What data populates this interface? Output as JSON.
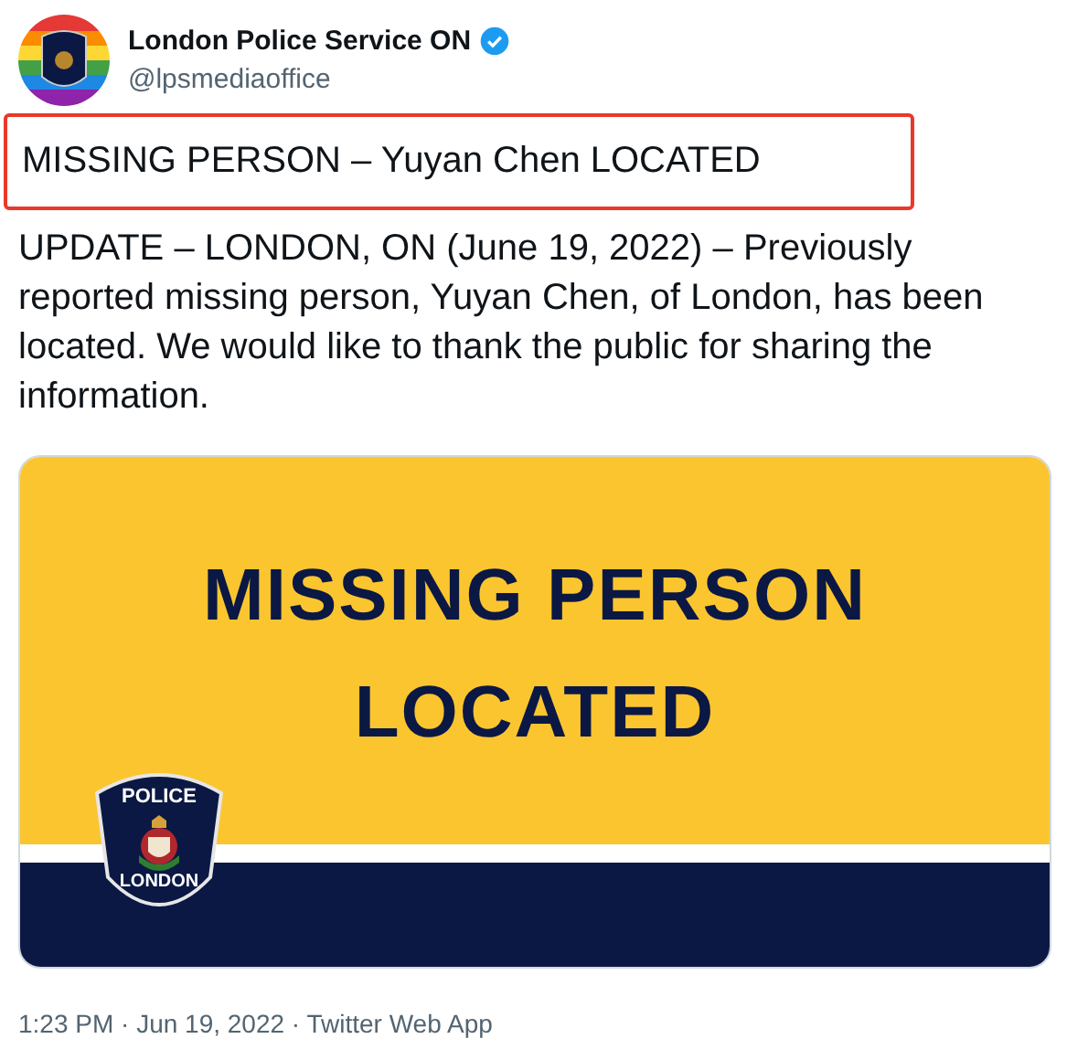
{
  "author": {
    "name": "London Police Service ON",
    "handle": "@lpsmediaoffice",
    "verified": true
  },
  "highlight": {
    "text": "MISSING PERSON –  Yuyan Chen LOCATED"
  },
  "body": "UPDATE – LONDON, ON (June 19, 2022) – Previously reported missing person, Yuyan Chen, of London, has been located. We would like to thank the public for sharing the information.",
  "media": {
    "headline": [
      "MISSING PERSON",
      "LOCATED"
    ],
    "badge_top": "POLICE",
    "badge_bottom": "LONDON"
  },
  "footer": "1:23 PM · Jun 19, 2022 · Twitter Web App"
}
